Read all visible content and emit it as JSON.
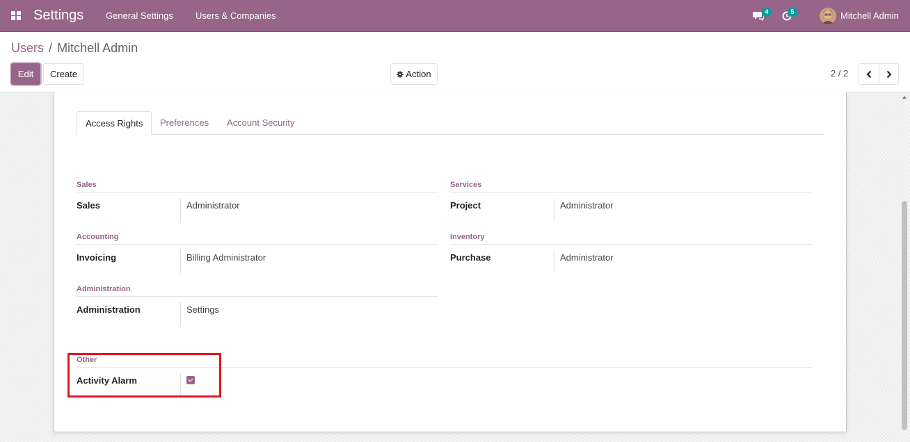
{
  "navbar": {
    "app_title": "Settings",
    "menu_items": [
      "General Settings",
      "Users & Companies"
    ],
    "messages_count": "4",
    "activities_count": "5",
    "user_name": "Mitchell Admin"
  },
  "breadcrumb": {
    "parent": "Users",
    "separator": "/",
    "current": "Mitchell Admin"
  },
  "toolbar": {
    "edit_label": "Edit",
    "create_label": "Create",
    "action_label": "Action",
    "pager_value": "2 / 2"
  },
  "tabs": [
    {
      "label": "Access Rights",
      "active": true
    },
    {
      "label": "Preferences",
      "active": false
    },
    {
      "label": "Account Security",
      "active": false
    }
  ],
  "groups": {
    "sales": {
      "title": "Sales",
      "field_label": "Sales",
      "field_value": "Administrator"
    },
    "services": {
      "title": "Services",
      "field_label": "Project",
      "field_value": "Administrator"
    },
    "accounting": {
      "title": "Accounting",
      "field_label": "Invoicing",
      "field_value": "Billing Administrator"
    },
    "inventory": {
      "title": "Inventory",
      "field_label": "Purchase",
      "field_value": "Administrator"
    },
    "administration": {
      "title": "Administration",
      "field_label": "Administration",
      "field_value": "Settings"
    },
    "other": {
      "title": "Other",
      "field_label": "Activity Alarm",
      "checked": true
    }
  },
  "colors": {
    "brand": "#976589",
    "badge": "#00a09d",
    "highlight": "#e8141f"
  },
  "icons": [
    "apps-grid-icon",
    "chat-icon",
    "clock-icon",
    "gear-icon",
    "chevron-left-icon",
    "chevron-right-icon"
  ]
}
